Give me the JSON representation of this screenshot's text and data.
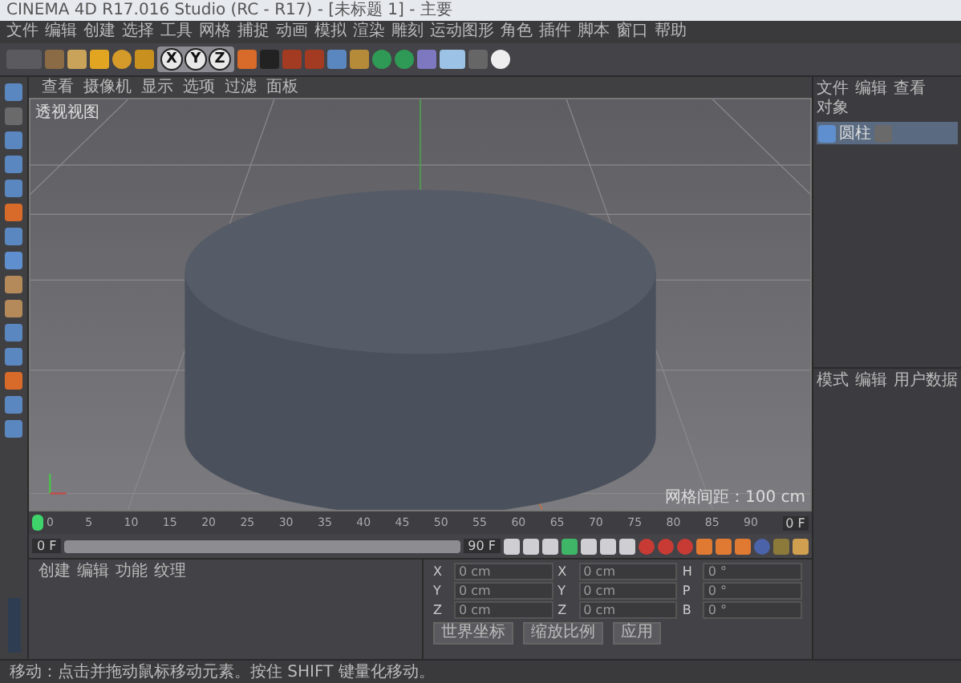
{
  "window": {
    "title": "CINEMA 4D R17.016 Studio (RC - R17) - [未标题 1] - 主要"
  },
  "menu": [
    "文件",
    "编辑",
    "创建",
    "选择",
    "工具",
    "网格",
    "捕捉",
    "动画",
    "模拟",
    "渲染",
    "雕刻",
    "运动图形",
    "角色",
    "插件",
    "脚本",
    "窗口",
    "帮助"
  ],
  "toolbar": {
    "axes": [
      "X",
      "Y",
      "Z"
    ]
  },
  "viewport": {
    "menu": [
      "查看",
      "摄像机",
      "显示",
      "选项",
      "过滤",
      "面板"
    ],
    "label": "透视视图",
    "grid_spacing": "网格间距：100 cm"
  },
  "objects": {
    "menu": [
      "文件",
      "编辑",
      "查看",
      "对象"
    ],
    "items": [
      {
        "name": "圆柱",
        "selected": true
      }
    ]
  },
  "attributes": {
    "menu": [
      "模式",
      "编辑",
      "用户数据"
    ]
  },
  "timeline": {
    "ticks": [
      "0",
      "5",
      "10",
      "15",
      "20",
      "25",
      "30",
      "35",
      "40",
      "45",
      "50",
      "55",
      "60",
      "65",
      "70",
      "75",
      "80",
      "85",
      "90"
    ],
    "current_frame": "0 F"
  },
  "transport": {
    "start": "0 F",
    "end": "90 F",
    "range": {
      "level": 1
    }
  },
  "materials": {
    "menu": [
      "创建",
      "编辑",
      "功能",
      "纹理"
    ]
  },
  "coordinates": {
    "rows": [
      {
        "axis": "X",
        "position": "0 cm",
        "size_axis": "X",
        "size": "0 cm",
        "rot_axis": "H",
        "rotation": "0 °"
      },
      {
        "axis": "Y",
        "position": "0 cm",
        "size_axis": "Y",
        "size": "0 cm",
        "rot_axis": "P",
        "rotation": "0 °"
      },
      {
        "axis": "Z",
        "position": "0 cm",
        "size_axis": "Z",
        "size": "0 cm",
        "rot_axis": "B",
        "rotation": "0 °"
      }
    ],
    "buttons": [
      "世界坐标",
      "缩放比例",
      "应用"
    ]
  },
  "status_bar": "移动：点击并拖动鼠标移动元素。按住 SHIFT 键量化移动。"
}
